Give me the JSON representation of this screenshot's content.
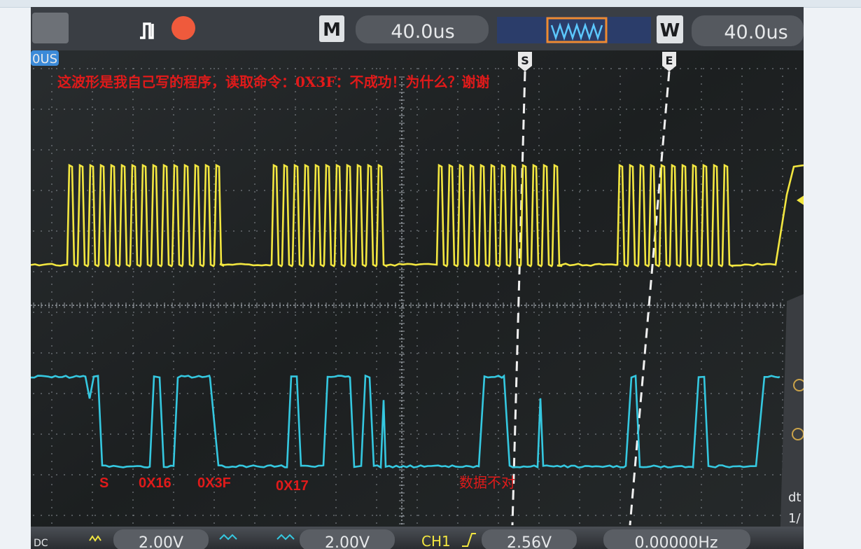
{
  "scope": {
    "timebase_badge": "M",
    "timebase_value": "40.0us",
    "window_badge": "W",
    "window_value": "40.0us",
    "left_time_fragment": "0US",
    "cursor_start_marker": "S",
    "cursor_end_marker": "E",
    "ch1_scale": "2.00V",
    "ch2_scale": "2.00V",
    "coupling_label": "DC",
    "trigger_source": "CH1",
    "trigger_level": "2.56V",
    "frequency": "0.00000Hz",
    "right_edge_fragment": "dt",
    "right_edge_fragment_2": "1/",
    "trace_colors": {
      "ch1": "#f2e640",
      "ch2": "#35c8e0"
    }
  },
  "annotations": {
    "question": "这波形是我自己写的程序，读取命令：0X3F：不成功！为什么？谢谢",
    "label_start": "S",
    "label_byte1": "0X16",
    "label_byte2": "0X3F",
    "label_byte3": "0X17",
    "label_bad_data": "数据不对",
    "color": "#e01a1a"
  }
}
